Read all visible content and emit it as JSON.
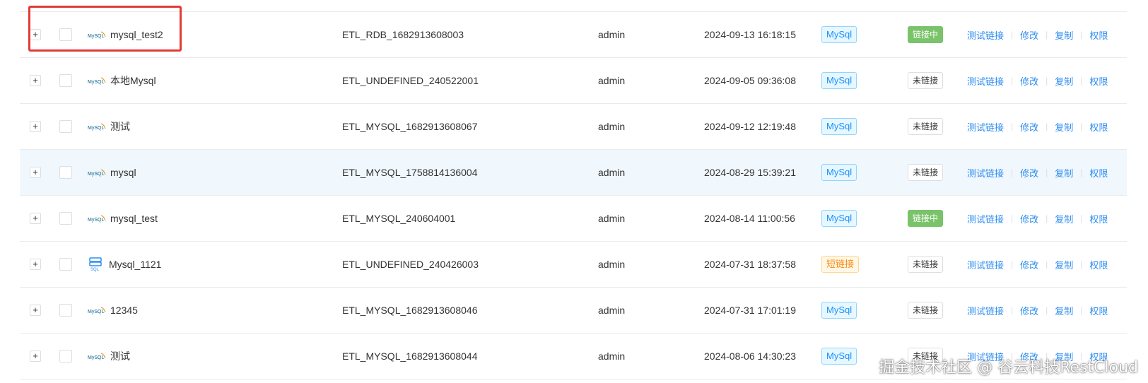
{
  "rows": [
    {
      "name": "mysql_test2",
      "code": "ETL_RDB_1682913608003",
      "user": "admin",
      "time": "2024-09-13 16:18:15",
      "type": "MySql",
      "status": "链接中",
      "icon": "mysql-logo-icon"
    },
    {
      "name": "本地Mysql",
      "code": "ETL_UNDEFINED_240522001",
      "user": "admin",
      "time": "2024-09-05 09:36:08",
      "type": "MySql",
      "status": "未链接",
      "icon": "mysql-logo-icon"
    },
    {
      "name": "测试",
      "code": "ETL_MYSQL_1682913608067",
      "user": "admin",
      "time": "2024-09-12 12:19:48",
      "type": "MySql",
      "status": "未链接",
      "icon": "mysql-logo-icon"
    },
    {
      "name": "mysql",
      "code": "ETL_MYSQL_1758814136004",
      "user": "admin",
      "time": "2024-08-29 15:39:21",
      "type": "MySql",
      "status": "未链接",
      "icon": "mysql-logo-icon"
    },
    {
      "name": "mysql_test",
      "code": "ETL_MYSQL_240604001",
      "user": "admin",
      "time": "2024-08-14 11:00:56",
      "type": "MySql",
      "status": "链接中",
      "icon": "mysql-logo-icon"
    },
    {
      "name": "Mysql_1121",
      "code": "ETL_UNDEFINED_240426003",
      "user": "admin",
      "time": "2024-07-31 18:37:58",
      "type": "短链接",
      "status": "未链接",
      "icon": "sql-server-icon"
    },
    {
      "name": "12345",
      "code": "ETL_MYSQL_1682913608046",
      "user": "admin",
      "time": "2024-07-31 17:01:19",
      "type": "MySql",
      "status": "未链接",
      "icon": "mysql-logo-icon"
    },
    {
      "name": "测试",
      "code": "ETL_MYSQL_1682913608044",
      "user": "admin",
      "time": "2024-08-06 14:30:23",
      "type": "MySql",
      "status": "未链接",
      "icon": "mysql-logo-icon"
    }
  ],
  "expand_symbol": "+",
  "actions": {
    "test": "测试链接",
    "edit": "修改",
    "copy": "复制",
    "perm": "权限"
  },
  "separator": "|",
  "watermark": "掘金技术社区 @ 谷云科技RestCloud",
  "colors": {
    "link": "#2d8cf0",
    "connected": "#7ac36a",
    "highlight_box": "#e53935",
    "row_hover": "#f0f7fd"
  }
}
